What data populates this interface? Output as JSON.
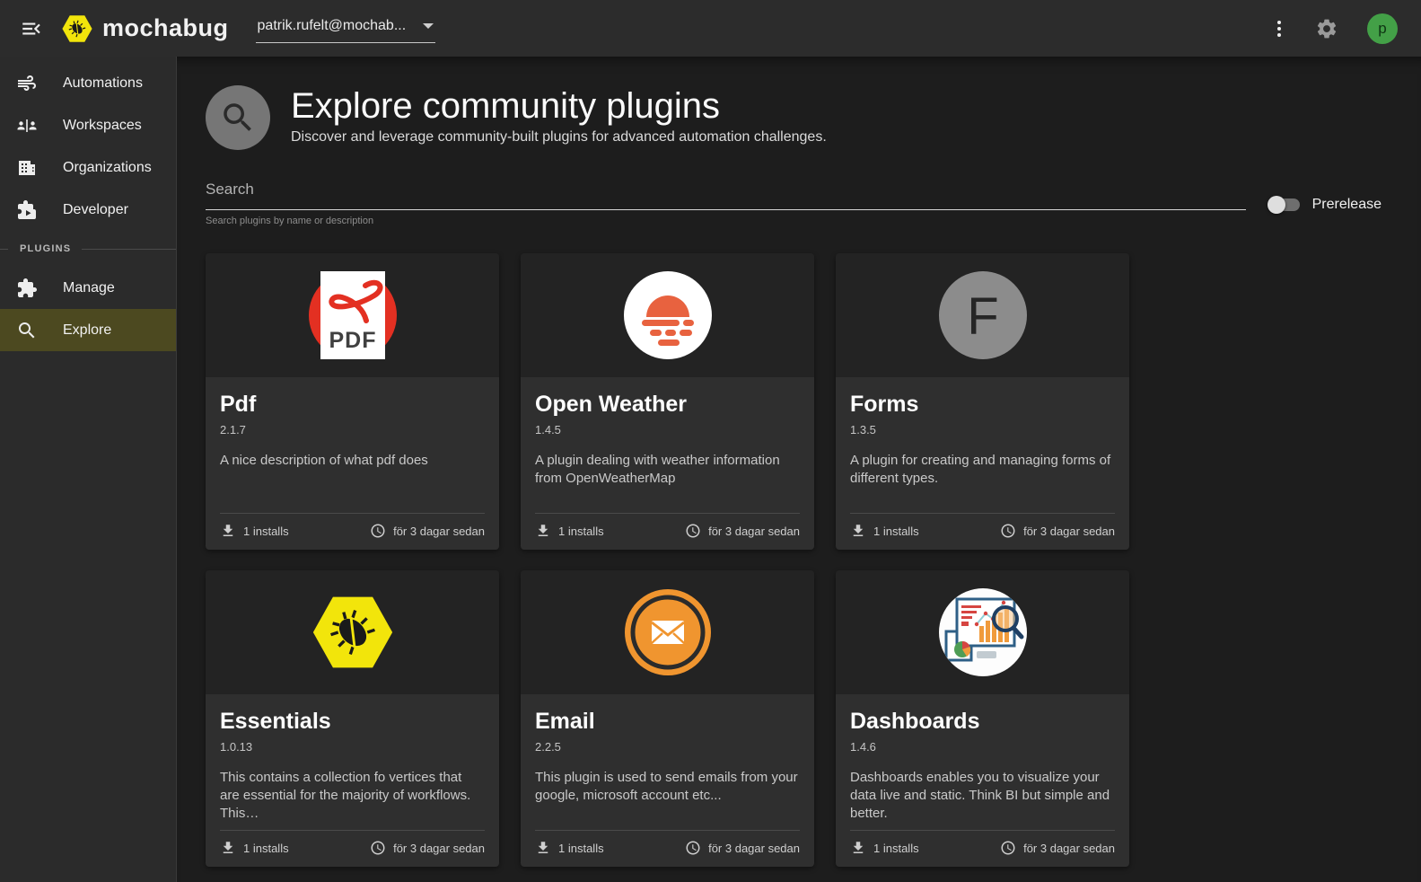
{
  "topbar": {
    "brand": "mochabug",
    "account_email": "patrik.rufelt@mochab...",
    "avatar_letter": "p"
  },
  "sidebar": {
    "items": [
      {
        "label": "Automations"
      },
      {
        "label": "Workspaces"
      },
      {
        "label": "Organizations"
      },
      {
        "label": "Developer"
      }
    ],
    "section": "PLUGINS",
    "plugin_items": [
      {
        "label": "Manage"
      },
      {
        "label": "Explore",
        "selected": true
      }
    ]
  },
  "header": {
    "title": "Explore community plugins",
    "subtitle": "Discover and leverage community-built plugins for advanced automation challenges."
  },
  "search": {
    "placeholder": "Search",
    "helper": "Search plugins by name or description",
    "prerelease_label": "Prerelease",
    "prerelease_on": false
  },
  "cards": [
    {
      "title": "Pdf",
      "version": "2.1.7",
      "description": "A nice description of what pdf does",
      "installs": "1 installs",
      "updated": "för 3 dagar sedan",
      "icon": "pdf"
    },
    {
      "title": "Open Weather",
      "version": "1.4.5",
      "description": "A plugin dealing with weather information from OpenWeatherMap",
      "installs": "1 installs",
      "updated": "för 3 dagar sedan",
      "icon": "openweather"
    },
    {
      "title": "Forms",
      "version": "1.3.5",
      "description": "A plugin for creating and managing forms of different types.",
      "installs": "1 installs",
      "updated": "för 3 dagar sedan",
      "icon": "forms"
    },
    {
      "title": "Essentials",
      "version": "1.0.13",
      "description": "This contains a collection fo vertices that are essential for the majority of workflows. This…",
      "installs": "1 installs",
      "updated": "för 3 dagar sedan",
      "icon": "essentials"
    },
    {
      "title": "Email",
      "version": "2.2.5",
      "description": "This plugin is used to send emails from your google, microsoft account etc...",
      "installs": "1 installs",
      "updated": "för 3 dagar sedan",
      "icon": "email"
    },
    {
      "title": "Dashboards",
      "version": "1.4.6",
      "description": "Dashboards enables you to visualize your data live and static. Think BI but simple and better.",
      "installs": "1 installs",
      "updated": "för 3 dagar sedan",
      "icon": "dashboards"
    }
  ],
  "colors": {
    "brand_yellow": "#f2e50b",
    "avatar_green": "#43a047",
    "selected_nav": "#4c4920",
    "pdf_red": "#e33022",
    "weather_red": "#e8623f",
    "email_orange": "#f0952f"
  }
}
